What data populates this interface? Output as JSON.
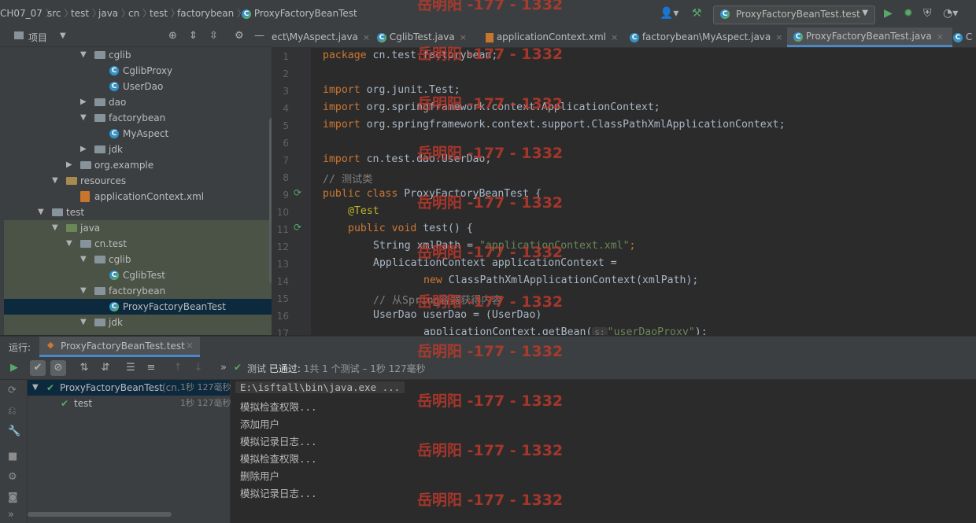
{
  "navbar": {
    "crumbs": [
      "CH07_07",
      "src",
      "test",
      "java",
      "cn",
      "test",
      "factorybean",
      "ProxyFactoryBeanTest"
    ],
    "run_config": "ProxyFactoryBeanTest.test"
  },
  "project_panel": {
    "title": "项目",
    "tree": [
      {
        "label": "cglib",
        "kind": "folder"
      },
      {
        "label": "CglibProxy",
        "kind": "class"
      },
      {
        "label": "UserDao",
        "kind": "class"
      },
      {
        "label": "dao",
        "kind": "folder"
      },
      {
        "label": "factorybean",
        "kind": "folder"
      },
      {
        "label": "MyAspect",
        "kind": "class"
      },
      {
        "label": "jdk",
        "kind": "folder"
      },
      {
        "label": "org.example",
        "kind": "folder"
      },
      {
        "label": "resources",
        "kind": "folder"
      },
      {
        "label": "applicationContext.xml",
        "kind": "xml"
      },
      {
        "label": "test",
        "kind": "folder"
      },
      {
        "label": "java",
        "kind": "folder"
      },
      {
        "label": "cn.test",
        "kind": "folder"
      },
      {
        "label": "cglib",
        "kind": "folder"
      },
      {
        "label": "CglibTest",
        "kind": "testclass"
      },
      {
        "label": "factorybean",
        "kind": "folder"
      },
      {
        "label": "ProxyFactoryBeanTest",
        "kind": "testclass"
      },
      {
        "label": "jdk",
        "kind": "folder"
      }
    ]
  },
  "editor_tabs": [
    {
      "label": "ect\\MyAspect.java"
    },
    {
      "label": "CglibTest.java"
    },
    {
      "label": "applicationContext.xml"
    },
    {
      "label": "factorybean\\MyAspect.java"
    },
    {
      "label": "ProxyFactoryBeanTest.java"
    },
    {
      "label": "C"
    }
  ],
  "code_lines": {
    "l1": [
      "package",
      " cn.test.factorybean;"
    ],
    "l3": [
      "import",
      " org.junit.Test;"
    ],
    "l4": [
      "import",
      " org.springframework.context.ApplicationContext;"
    ],
    "l5": [
      "import",
      " org.springframework.context.support.ClassPathXmlApplicationContext;"
    ],
    "l7": [
      "import",
      " cn.test.dao.UserDao;"
    ],
    "l8": "// 测试类",
    "l9": [
      "public class",
      " ProxyFactoryBeanTest {"
    ],
    "l10": "@Test",
    "l11": [
      "public void",
      " test() {"
    ],
    "l12": [
      "String xmlPath = ",
      "\"applicationContext.xml\"",
      ";"
    ],
    "l13": "ApplicationContext applicationContext =",
    "l14": [
      "new",
      " ClassPathXmlApplicationContext(xmlPath);"
    ],
    "l15": "// 从Spring容器获得内容",
    "l16": "UserDao userDao = (UserDao)",
    "l17": [
      "applicationContext.getBean(",
      "s:",
      "\"userDaoProxy\"",
      ");"
    ]
  },
  "run": {
    "label": "运行:",
    "tab": "ProxyFactoryBeanTest.test",
    "status_prefix": "测试",
    "status_passed": "已通过:",
    "status_detail": "1共 1 个测试 – 1秒 127毫秒",
    "tests": [
      {
        "name": "ProxyFactoryBeanTest",
        "pkg": "(cn.",
        "time": "1秒 127毫秒"
      },
      {
        "name": "test",
        "time": "1秒 127毫秒"
      }
    ],
    "console": [
      "E:\\isftall\\bin\\java.exe ...",
      "模拟检查权限...",
      "添加用户",
      "模拟记录日志...",
      "模拟检查权限...",
      "删除用户",
      "模拟记录日志..."
    ]
  },
  "watermark": "岳明阳 -177 - 1332"
}
